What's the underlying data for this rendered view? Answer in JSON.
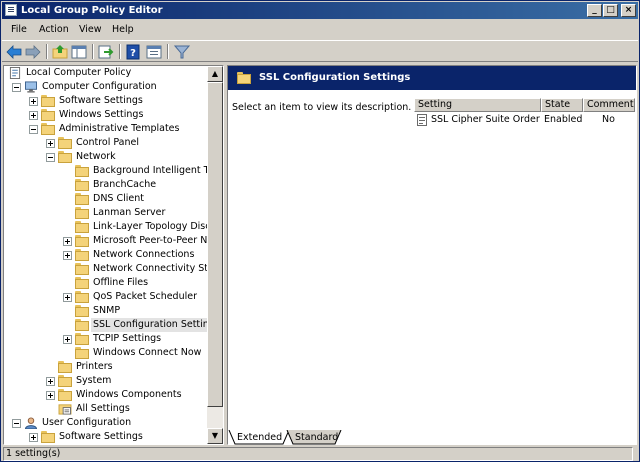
{
  "window": {
    "title": "Local Group Policy Editor"
  },
  "title_buttons": {
    "minimize": "_",
    "maximize": "□",
    "close": "×"
  },
  "menu": [
    "File",
    "Action",
    "View",
    "Help"
  ],
  "toolbar_icons": [
    "back-icon",
    "forward-icon",
    "up-folder-icon",
    "show-tree-icon",
    "export-icon",
    "help-icon",
    "properties-icon",
    "filter-icon"
  ],
  "tree": [
    {
      "label": "Local Computer Policy",
      "level": 0,
      "expander": "",
      "icon": "policy"
    },
    {
      "label": "Computer Configuration",
      "level": 1,
      "expander": "minus",
      "icon": "computer"
    },
    {
      "label": "Software Settings",
      "level": 2,
      "expander": "plus",
      "icon": "folder"
    },
    {
      "label": "Windows Settings",
      "level": 2,
      "expander": "plus",
      "icon": "folder"
    },
    {
      "label": "Administrative Templates",
      "level": 2,
      "expander": "minus",
      "icon": "folder"
    },
    {
      "label": "Control Panel",
      "level": 3,
      "expander": "plus",
      "icon": "folder"
    },
    {
      "label": "Network",
      "level": 3,
      "expander": "minus",
      "icon": "folder"
    },
    {
      "label": "Background Intelligent Trans",
      "level": 4,
      "expander": "",
      "icon": "folder"
    },
    {
      "label": "BranchCache",
      "level": 4,
      "expander": "",
      "icon": "folder"
    },
    {
      "label": "DNS Client",
      "level": 4,
      "expander": "",
      "icon": "folder"
    },
    {
      "label": "Lanman Server",
      "level": 4,
      "expander": "",
      "icon": "folder"
    },
    {
      "label": "Link-Layer Topology Discove",
      "level": 4,
      "expander": "",
      "icon": "folder"
    },
    {
      "label": "Microsoft Peer-to-Peer Netw",
      "level": 4,
      "expander": "plus",
      "icon": "folder"
    },
    {
      "label": "Network Connections",
      "level": 4,
      "expander": "plus",
      "icon": "folder"
    },
    {
      "label": "Network Connectivity Status",
      "level": 4,
      "expander": "",
      "icon": "folder"
    },
    {
      "label": "Offline Files",
      "level": 4,
      "expander": "",
      "icon": "folder"
    },
    {
      "label": "QoS Packet Scheduler",
      "level": 4,
      "expander": "plus",
      "icon": "folder"
    },
    {
      "label": "SNMP",
      "level": 4,
      "expander": "",
      "icon": "folder"
    },
    {
      "label": "SSL Configuration Settings",
      "level": 4,
      "expander": "",
      "icon": "folder",
      "selected": true
    },
    {
      "label": "TCPIP Settings",
      "level": 4,
      "expander": "plus",
      "icon": "folder"
    },
    {
      "label": "Windows Connect Now",
      "level": 4,
      "expander": "",
      "icon": "folder"
    },
    {
      "label": "Printers",
      "level": 3,
      "expander": "",
      "icon": "folder"
    },
    {
      "label": "System",
      "level": 3,
      "expander": "plus",
      "icon": "folder"
    },
    {
      "label": "Windows Components",
      "level": 3,
      "expander": "plus",
      "icon": "folder"
    },
    {
      "label": "All Settings",
      "level": 3,
      "expander": "",
      "icon": "settings"
    },
    {
      "label": "User Configuration",
      "level": 1,
      "expander": "minus",
      "icon": "user"
    },
    {
      "label": "Software Settings",
      "level": 2,
      "expander": "plus",
      "icon": "folder"
    }
  ],
  "right_pane": {
    "title": "SSL Configuration Settings",
    "description": "Select an item to view its description.",
    "columns": [
      "Setting",
      "State",
      "Comment"
    ],
    "rows": [
      {
        "setting": "SSL Cipher Suite Order",
        "state": "Enabled",
        "comment": "No"
      }
    ]
  },
  "tabs": [
    "Extended",
    "Standard"
  ],
  "status": "1 setting(s)",
  "colors": {
    "title_bar": "#0a246a",
    "pane_header": "#0a246a",
    "folder": "#f4d37a",
    "face": "#d4d0c8"
  }
}
